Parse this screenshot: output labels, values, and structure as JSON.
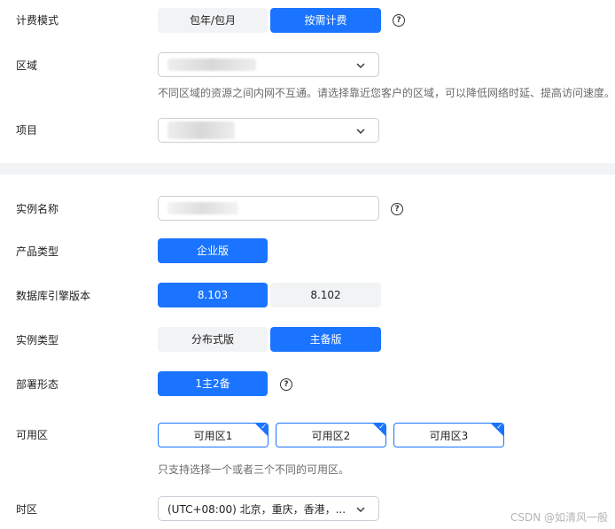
{
  "billing": {
    "label": "计费模式",
    "options": [
      "包年/包月",
      "按需计费"
    ]
  },
  "region": {
    "label": "区域",
    "hint": "不同区域的资源之间内网不互通。请选择靠近您客户的区域，可以降低网络时延、提高访问速度。"
  },
  "project": {
    "label": "项目"
  },
  "instance_name": {
    "label": "实例名称"
  },
  "product_type": {
    "label": "产品类型",
    "options": [
      "企业版"
    ]
  },
  "engine_version": {
    "label": "数据库引擎版本",
    "options": [
      "8.103",
      "8.102"
    ]
  },
  "instance_type": {
    "label": "实例类型",
    "options": [
      "分布式版",
      "主备版"
    ]
  },
  "deploy_form": {
    "label": "部署形态",
    "options": [
      "1主2备"
    ]
  },
  "availability_zone": {
    "label": "可用区",
    "options": [
      "可用区1",
      "可用区2",
      "可用区3"
    ],
    "hint": "只支持选择一个或者三个不同的可用区。"
  },
  "timezone": {
    "label": "时区",
    "value": "(UTC+08:00) 北京，重庆，香港，..."
  },
  "watermark": "CSDN @如清风一般",
  "colors": {
    "accent": "#1a74ff",
    "segment_off": "#f2f3f5",
    "border": "#c9ced6"
  },
  "icons": {
    "help": "question-circle-icon",
    "dropdown": "chevron-down-icon",
    "selected_corner": "check-corner-icon"
  }
}
